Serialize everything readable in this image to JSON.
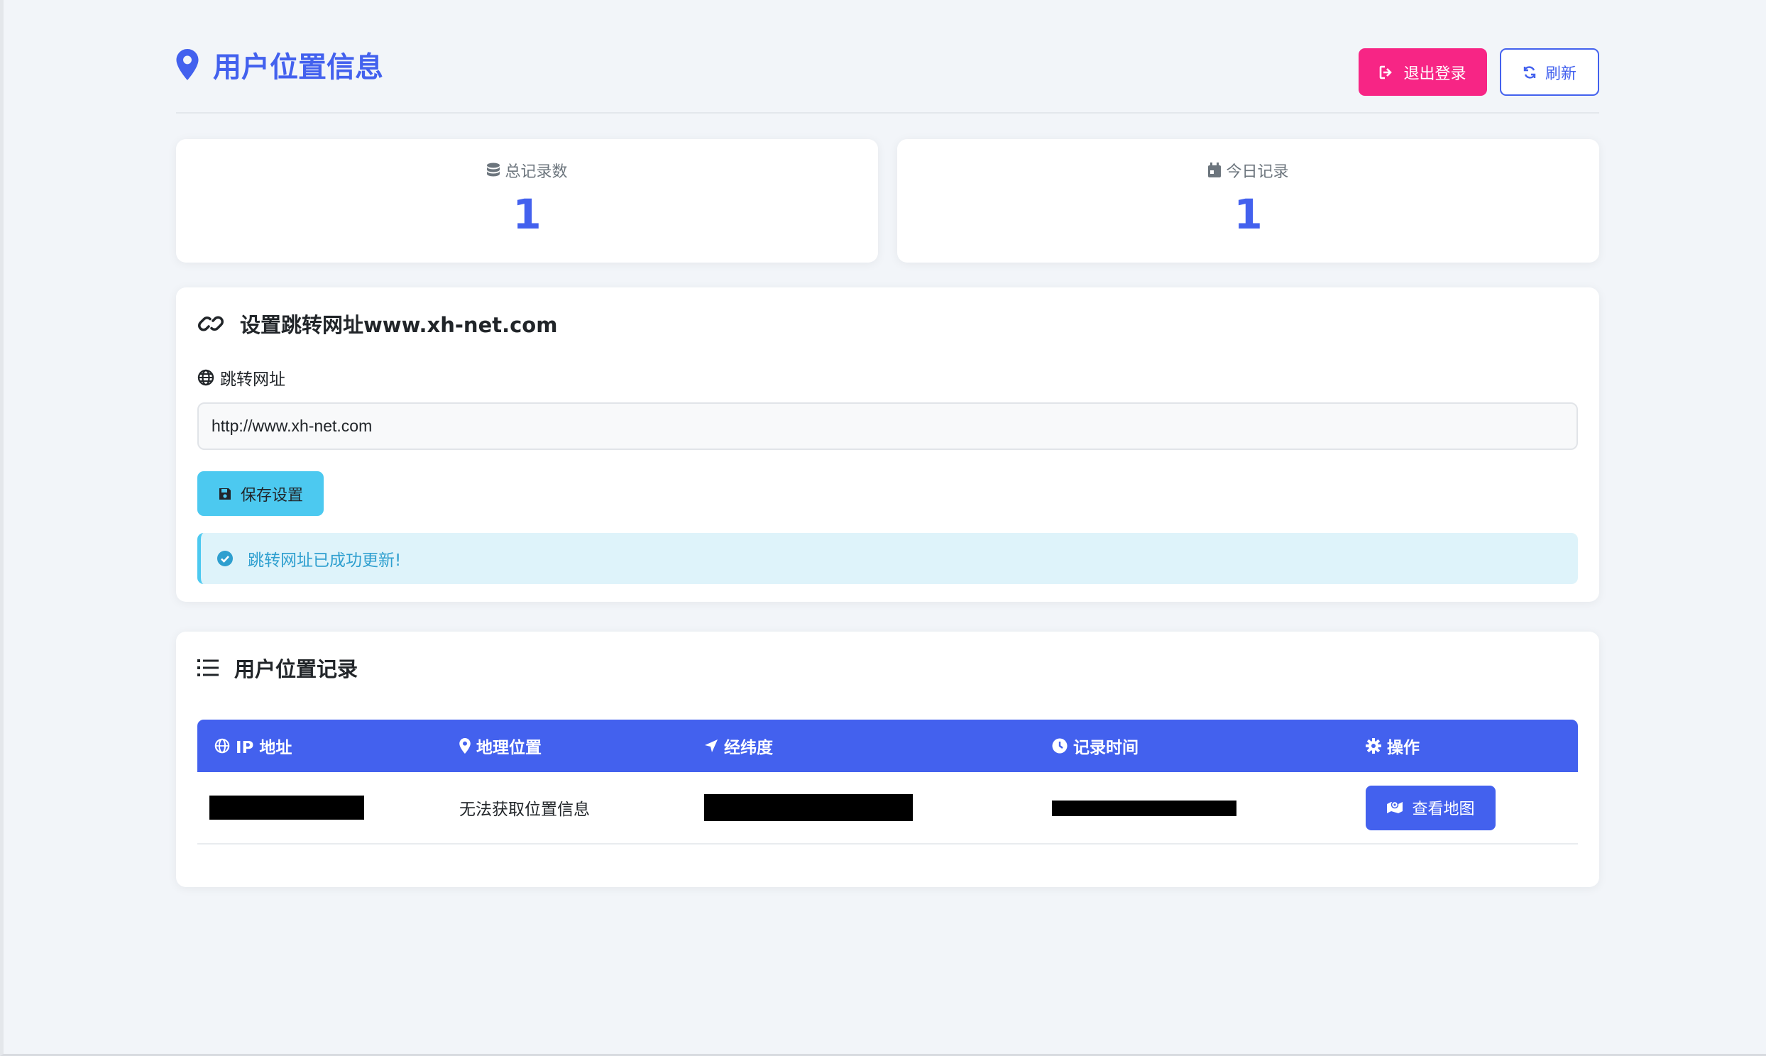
{
  "header": {
    "title": "用户位置信息",
    "logout_label": "退出登录",
    "refresh_label": "刷新"
  },
  "stats": {
    "total_label": "总记录数",
    "total_value": "1",
    "today_label": "今日记录",
    "today_value": "1"
  },
  "settings": {
    "title": "设置跳转网址www.xh-net.com",
    "field_label": "跳转网址",
    "url_value": "http://www.xh-net.com",
    "save_label": "保存设置",
    "alert_text": "跳转网址已成功更新!"
  },
  "records": {
    "title": "用户位置记录",
    "columns": {
      "ip": "IP 地址",
      "location": "地理位置",
      "coords": "经纬度",
      "time": "记录时间",
      "action": "操作"
    },
    "rows": [
      {
        "location": "无法获取位置信息",
        "action_label": "查看地图"
      }
    ]
  },
  "colors": {
    "primary": "#4361ee",
    "danger": "#f72585",
    "info": "#4cc9f0"
  },
  "icons": {
    "title": "map-marker-icon",
    "logout": "sign-out-icon",
    "refresh": "refresh-icon",
    "total": "database-icon",
    "today": "calendar-icon",
    "settings": "link-icon",
    "field": "globe-icon",
    "save": "save-icon",
    "alert": "check-circle-icon",
    "records": "list-icon"
  }
}
